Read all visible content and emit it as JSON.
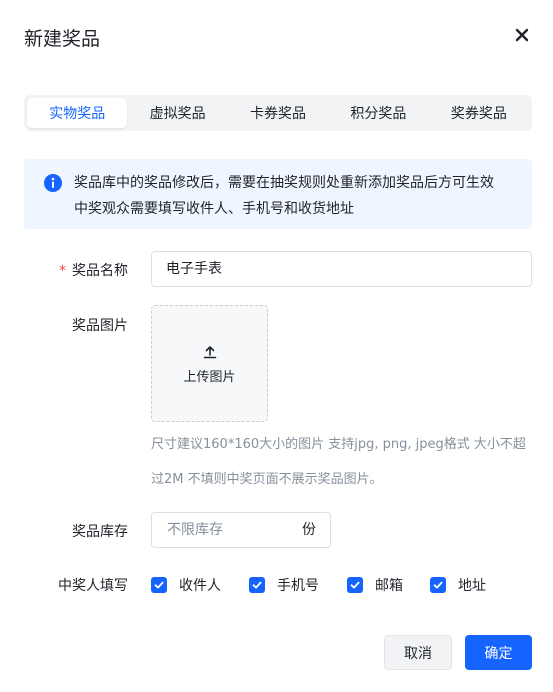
{
  "dialog": {
    "title": "新建奖品",
    "close_icon": "close-icon"
  },
  "tabs": [
    {
      "label": "实物奖品",
      "active": true
    },
    {
      "label": "虚拟奖品",
      "active": false
    },
    {
      "label": "卡券奖品",
      "active": false
    },
    {
      "label": "积分奖品",
      "active": false
    },
    {
      "label": "奖券奖品",
      "active": false
    }
  ],
  "notice": {
    "icon": "info-icon",
    "line1": "奖品库中的奖品修改后，需要在抽奖规则处重新添加奖品后方可生效",
    "line2": "中奖观众需要填写收件人、手机号和收货地址"
  },
  "form": {
    "name": {
      "required_mark": "*",
      "label": "奖品名称",
      "value": "电子手表"
    },
    "image": {
      "label": "奖品图片",
      "upload_icon": "upload-icon",
      "upload_text": "上传图片",
      "hint_line1": "尺寸建议160*160大小的图片  支持jpg, png, jpeg格式  大小不超",
      "hint_line2": "过2M  不填则中奖页面不展示奖品图片。"
    },
    "stock": {
      "label": "奖品库存",
      "placeholder": "不限库存",
      "unit": "份"
    },
    "winner_fields": {
      "label": "中奖人填写",
      "options": [
        {
          "label": "收件人",
          "checked": true
        },
        {
          "label": "手机号",
          "checked": true
        },
        {
          "label": "邮箱",
          "checked": true
        },
        {
          "label": "地址",
          "checked": true
        }
      ]
    }
  },
  "footer": {
    "cancel_label": "取消",
    "ok_label": "确定"
  },
  "colors": {
    "primary": "#1664ff",
    "required": "#f53f3f",
    "notice_bg": "#f0f6ff"
  }
}
